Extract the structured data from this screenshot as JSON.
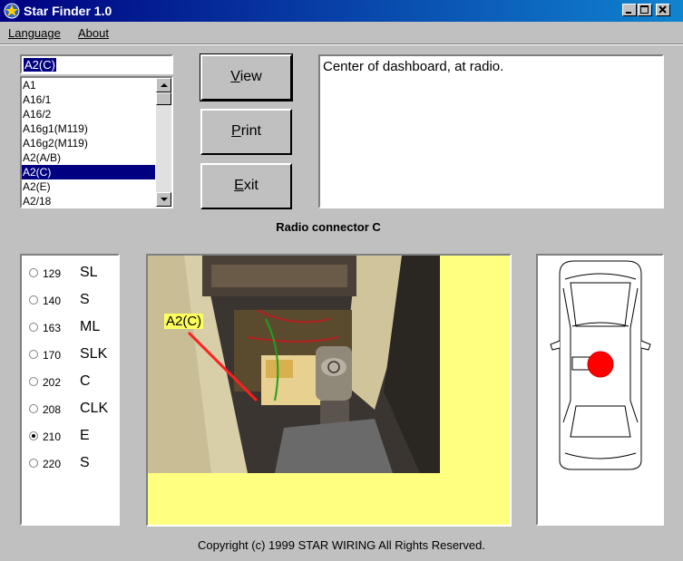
{
  "window": {
    "title": "Star Finder 1.0"
  },
  "menu": {
    "language": "Language",
    "about": "About"
  },
  "search": {
    "value": "A2(C)"
  },
  "list": {
    "items": [
      "A1",
      "A16/1",
      "A16/2",
      "A16g1(M119)",
      "A16g2(M119)",
      "A2(A/B)",
      "A2(C)",
      "A2(E)",
      "A2/18"
    ],
    "selected_index": 6
  },
  "buttons": {
    "view": "View",
    "print": "Print",
    "exit": "Exit"
  },
  "description": "Center of dashboard, at radio.",
  "caption": "Radio connector C",
  "models": [
    {
      "num": "129",
      "cls": "SL",
      "selected": false
    },
    {
      "num": "140",
      "cls": "S",
      "selected": false
    },
    {
      "num": "163",
      "cls": "ML",
      "selected": false
    },
    {
      "num": "170",
      "cls": "SLK",
      "selected": false
    },
    {
      "num": "202",
      "cls": "C",
      "selected": false
    },
    {
      "num": "208",
      "cls": "CLK",
      "selected": false
    },
    {
      "num": "210",
      "cls": "E",
      "selected": true
    },
    {
      "num": "220",
      "cls": "S",
      "selected": false
    }
  ],
  "photo": {
    "label": "A2(C)"
  },
  "colors": {
    "title_bar": "#000080",
    "photo_background": "#ffff80",
    "location_marker": "#ff0000"
  },
  "footer": {
    "copyright": "Copyright (c) 1999 STAR WIRING  All Rights Reserved."
  }
}
